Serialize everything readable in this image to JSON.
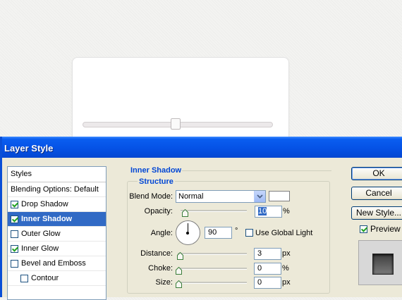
{
  "dialog": {
    "title": "Layer Style"
  },
  "styles_panel": {
    "header": "Styles",
    "items": [
      {
        "label": "Blending Options: Default",
        "checkbox": false,
        "checked": false,
        "selected": false,
        "sub": false
      },
      {
        "label": "Drop Shadow",
        "checkbox": true,
        "checked": true,
        "selected": false,
        "sub": false
      },
      {
        "label": "Inner Shadow",
        "checkbox": true,
        "checked": true,
        "selected": true,
        "sub": false
      },
      {
        "label": "Outer Glow",
        "checkbox": true,
        "checked": false,
        "selected": false,
        "sub": false
      },
      {
        "label": "Inner Glow",
        "checkbox": true,
        "checked": true,
        "selected": false,
        "sub": false
      },
      {
        "label": "Bevel and Emboss",
        "checkbox": true,
        "checked": false,
        "selected": false,
        "sub": false
      },
      {
        "label": "Contour",
        "checkbox": true,
        "checked": false,
        "selected": false,
        "sub": true
      }
    ]
  },
  "inner_shadow": {
    "section_title": "Inner Shadow",
    "group_title": "Structure",
    "blend_mode_label": "Blend Mode:",
    "blend_mode_value": "Normal",
    "shadow_color": "#ffffff",
    "opacity_label": "Opacity:",
    "opacity_value": "10",
    "opacity_unit": "%",
    "angle_label": "Angle:",
    "angle_value": "90",
    "angle_unit": "°",
    "use_global_light_label": "Use Global Light",
    "use_global_light_checked": false,
    "distance_label": "Distance:",
    "distance_value": "3",
    "distance_unit": "px",
    "choke_label": "Choke:",
    "choke_value": "0",
    "choke_unit": "%",
    "size_label": "Size:",
    "size_value": "0",
    "size_unit": "px"
  },
  "buttons": {
    "ok": "OK",
    "cancel": "Cancel",
    "new_style": "New Style...",
    "preview_label": "Preview",
    "preview_checked": true
  },
  "canvas": {
    "slider_value_fraction": 0.5
  },
  "colors": {
    "accent": "#0a5ef0",
    "selection": "#316ac5",
    "section_title": "#0046d5"
  }
}
